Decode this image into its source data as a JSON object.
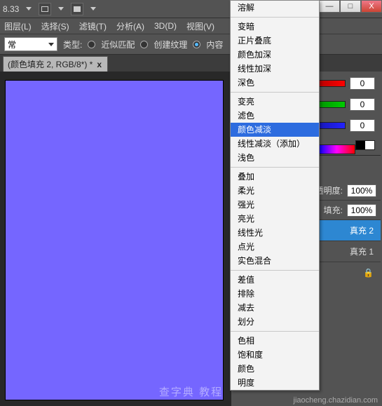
{
  "top": {
    "zoom": "8.33",
    "tri": "▼"
  },
  "win": {
    "min": "—",
    "max": "□",
    "close": "X"
  },
  "menu": {
    "layer": "图层(L)",
    "select": "选择(S)",
    "filter": "滤镜(T)",
    "analysis": "分析(A)",
    "threeD": "3D(D)",
    "view": "视图(V)"
  },
  "opt": {
    "mode": "常",
    "typeLabel": "类型:",
    "approx": "近似匹配",
    "create": "创建纹理",
    "content": "内容"
  },
  "tab": {
    "title": "(颜色填充 2, RGB/8*) *",
    "close": "x"
  },
  "color": {
    "r": "0",
    "g": "0",
    "b": "0"
  },
  "layers": {
    "opacityLabel": "不透明度:",
    "fillLabel": "填充:",
    "opacity": "100%",
    "fill": "100%",
    "fill2": "真充 2",
    "fill1": "真充 1",
    "lockIcon": "🔒"
  },
  "blend": {
    "items": [
      "溶解",
      "",
      "变暗",
      "正片叠底",
      "颜色加深",
      "线性加深",
      "深色",
      "",
      "变亮",
      "滤色",
      "颜色减淡",
      "线性减淡（添加）",
      "浅色",
      "",
      "叠加",
      "柔光",
      "强光",
      "亮光",
      "线性光",
      "点光",
      "实色混合",
      "",
      "差值",
      "排除",
      "减去",
      "划分",
      "",
      "色相",
      "饱和度",
      "颜色",
      "明度"
    ],
    "highlightIndex": 10
  },
  "wm": {
    "main": "查字典 教程",
    "sub": "jiaocheng.chazidian.com"
  }
}
